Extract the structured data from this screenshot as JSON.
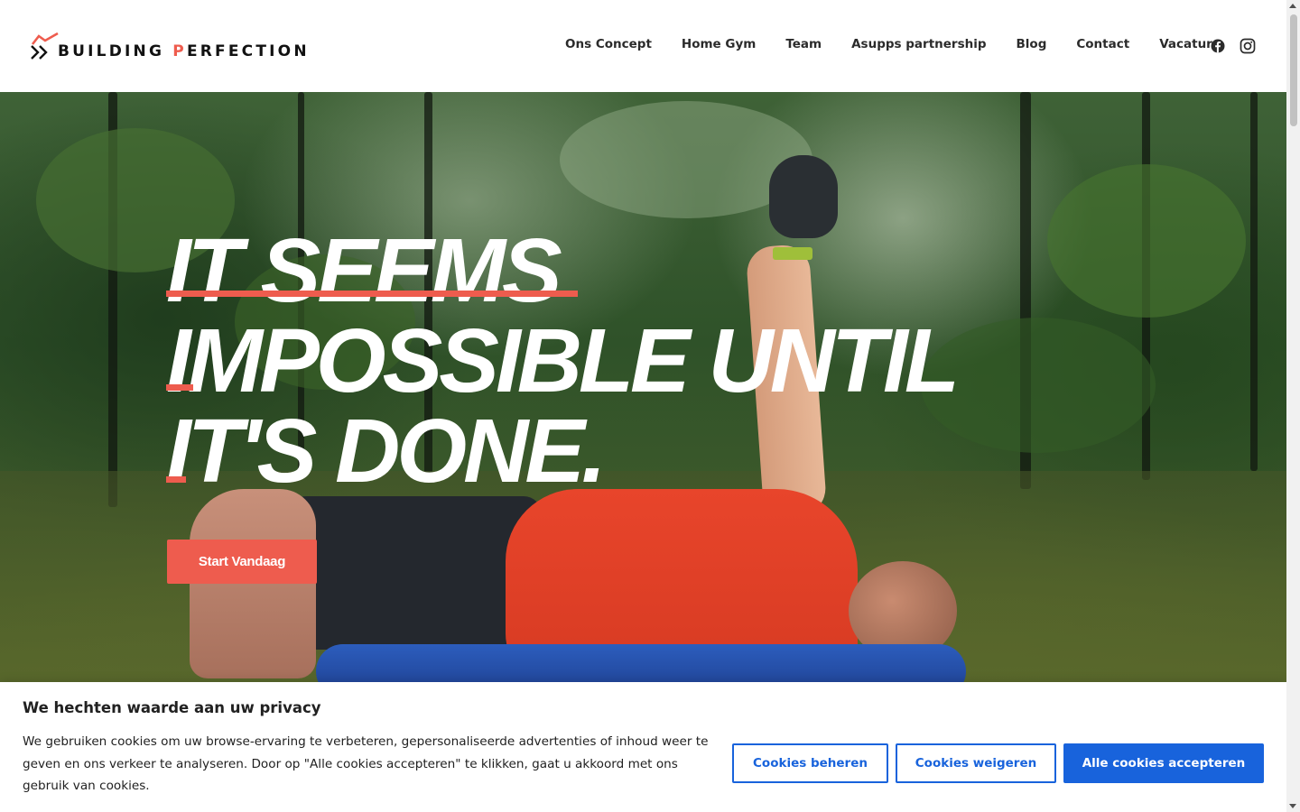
{
  "brand": {
    "name_part1": "BUILDING ",
    "name_accent": "P",
    "name_part2": "ERFECTION",
    "accent_color": "#ee5c4e"
  },
  "nav": {
    "items": [
      {
        "label": "Ons Concept"
      },
      {
        "label": "Home Gym"
      },
      {
        "label": "Team"
      },
      {
        "label": "Asupps partnership"
      },
      {
        "label": "Blog"
      },
      {
        "label": "Contact"
      },
      {
        "label": "Vacature"
      }
    ],
    "social": [
      {
        "icon": "facebook-icon"
      },
      {
        "icon": "instagram-icon"
      }
    ]
  },
  "hero": {
    "headline_lines": [
      "IT SEEMS",
      "IMPOSSIBLE UNTIL",
      "IT'S DONE."
    ],
    "cta_label": "Start Vandaag"
  },
  "cookie": {
    "title": "We hechten waarde aan uw privacy",
    "text": "We gebruiken cookies om uw browse-ervaring te verbeteren, gepersonaliseerde advertenties of inhoud weer te geven en ons verkeer te analyseren. Door op \"Alle cookies accepteren\" te klikken, gaat u akkoord met ons gebruik van cookies.",
    "manage_label": "Cookies beheren",
    "reject_label": "Cookies weigeren",
    "accept_label": "Alle cookies accepteren",
    "button_color": "#1863dc"
  }
}
